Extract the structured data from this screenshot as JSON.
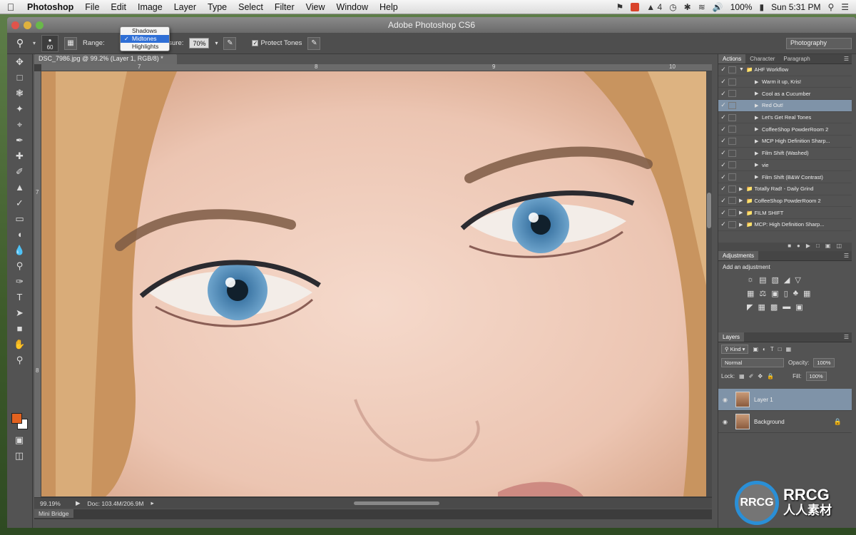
{
  "menubar": {
    "app_name": "Photoshop",
    "items": [
      "File",
      "Edit",
      "Image",
      "Layer",
      "Type",
      "Select",
      "Filter",
      "View",
      "Window",
      "Help"
    ],
    "adobe_count": "4",
    "battery": "100%",
    "clock": "Sun 5:31 PM"
  },
  "window": {
    "title": "Adobe Photoshop CS6"
  },
  "options": {
    "brush_size": "60",
    "range_label": "Range:",
    "exposure_label": "Exposure:",
    "exposure_value": "70%",
    "protect_tones": "Protect Tones",
    "workspace": "Photography"
  },
  "range_dropdown": {
    "options": [
      "Shadows",
      "Midtones",
      "Highlights"
    ],
    "selected": "Midtones"
  },
  "document": {
    "tab": "DSC_7986.jpg @ 99.2% (Layer 1, RGB/8) *",
    "ruler_h": [
      "7",
      "8",
      "9",
      "10"
    ],
    "ruler_v": [
      "7",
      "8"
    ],
    "zoom": "99.19%",
    "doc_size": "Doc: 103.4M/206.9M"
  },
  "minibridge": "Mini Bridge",
  "actions_panel": {
    "tabs": [
      "Actions",
      "Character",
      "Paragraph"
    ],
    "set_name": "AHF Workflow",
    "items": [
      "Warm it up, Kris!",
      "Cool as a Cucumber",
      "Red Out!",
      "Let's Get Real Tones",
      "CoffeeShop PowderRoom 2",
      "MCP High Definition Sharp...",
      "Film Shift (Washed)",
      "vie",
      "Film Shift (B&W Contrast)"
    ],
    "selected_item": "Red Out!",
    "other_sets": [
      "Totally Rad! - Daily Grind",
      "CoffeeShop PowderRoom 2",
      "FILM SHIFT",
      "MCP: High Definition Sharp..."
    ]
  },
  "adjustments_panel": {
    "tab": "Adjustments",
    "title": "Add an adjustment"
  },
  "layers_panel": {
    "tab": "Layers",
    "kind_label": "Kind",
    "blend_mode": "Normal",
    "opacity_label": "Opacity:",
    "opacity_value": "100%",
    "lock_label": "Lock:",
    "fill_label": "Fill:",
    "fill_value": "100%",
    "layers": [
      "Layer 1",
      "Background"
    ]
  },
  "watermark": {
    "logo": "RRCG",
    "brand": "RRCG",
    "sub": "人人素材"
  },
  "colors": {
    "foreground": "#e2621f",
    "background": "#ffffff",
    "selection": "#7f93a8",
    "accent": "#2f6fd6"
  }
}
